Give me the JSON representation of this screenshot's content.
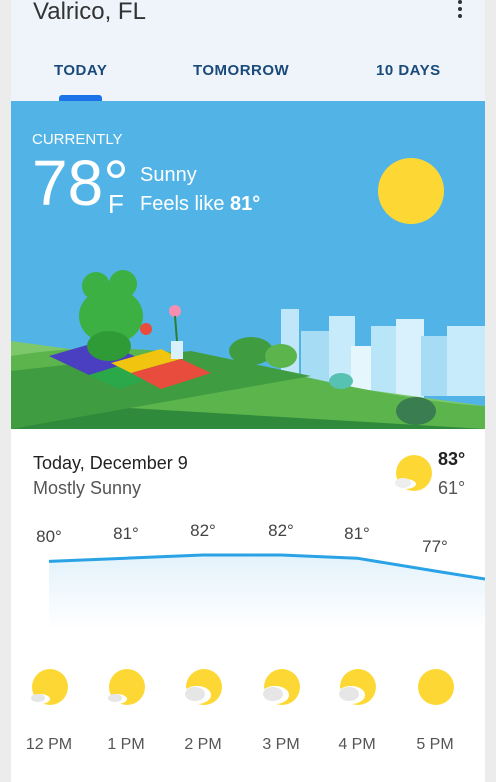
{
  "location": "Valrico, FL",
  "tabs": [
    {
      "label": "TODAY",
      "active": true
    },
    {
      "label": "TOMORROW",
      "active": false
    },
    {
      "label": "10 DAYS",
      "active": false
    }
  ],
  "current": {
    "heading": "CURRENTLY",
    "temperature": "78°",
    "unit": "F",
    "condition": "Sunny",
    "feels_like_prefix": "Feels like",
    "feels_like_value": "81°"
  },
  "today": {
    "title": "Today, December 9",
    "condition": "Mostly Sunny",
    "high": "83°",
    "low": "61°"
  },
  "hourly": [
    {
      "time": "12 PM",
      "temp": "80°",
      "value": 80,
      "icon": "mostly-sunny-icon"
    },
    {
      "time": "1 PM",
      "temp": "81°",
      "value": 81,
      "icon": "mostly-sunny-icon"
    },
    {
      "time": "2 PM",
      "temp": "82°",
      "value": 82,
      "icon": "partly-cloudy-icon"
    },
    {
      "time": "3 PM",
      "temp": "82°",
      "value": 82,
      "icon": "partly-cloudy-icon"
    },
    {
      "time": "4 PM",
      "temp": "81°",
      "value": 81,
      "icon": "partly-cloudy-icon"
    },
    {
      "time": "5 PM",
      "temp": "77°",
      "value": 77,
      "icon": "sunny-icon"
    }
  ],
  "colors": {
    "sky": "#52b4e6",
    "sun": "#fdd835",
    "tab_text": "#1a4a7a",
    "indicator": "#1a73e8",
    "line": "#29a3e5"
  }
}
